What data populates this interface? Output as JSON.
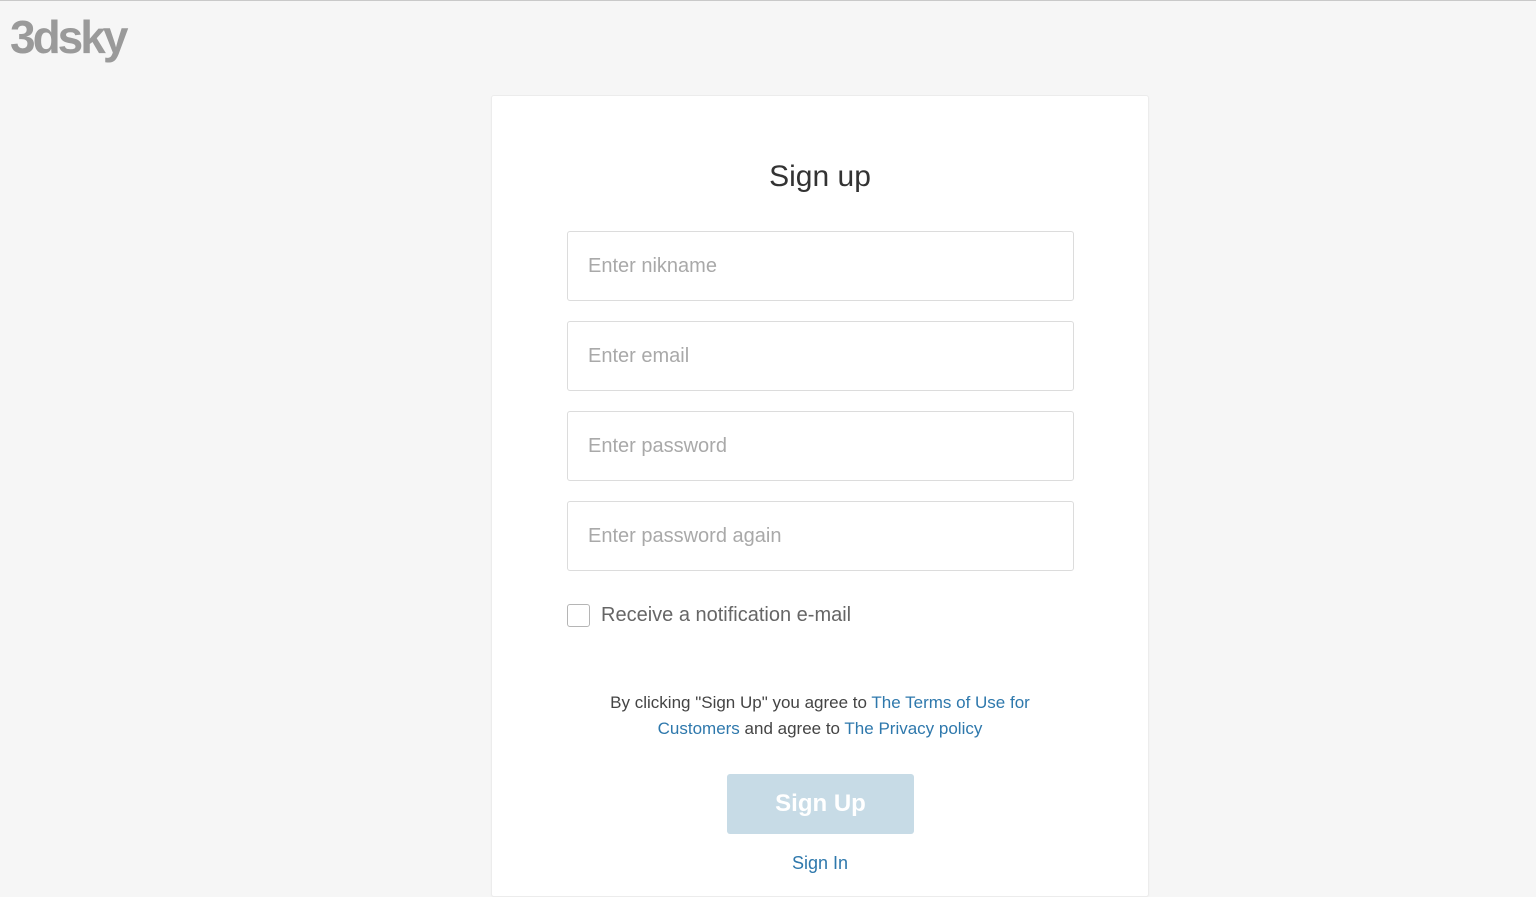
{
  "brand": {
    "logo_text": "3dsky",
    "logo_color": "#9a9a9a"
  },
  "form": {
    "title": "Sign up",
    "nickname": {
      "placeholder": "Enter nikname",
      "value": ""
    },
    "email": {
      "placeholder": "Enter email",
      "value": ""
    },
    "password": {
      "placeholder": "Enter password",
      "value": ""
    },
    "password_again": {
      "placeholder": "Enter password again",
      "value": ""
    },
    "notification_checkbox": {
      "label": "Receive a notification e-mail",
      "checked": false
    },
    "terms": {
      "prefix": "By clicking \"Sign Up\" you agree to ",
      "terms_link": "The Terms of Use for Customers",
      "middle": " and agree to ",
      "privacy_link": "The Privacy policy"
    },
    "submit_label": "Sign Up",
    "signin_label": "Sign In"
  },
  "colors": {
    "background": "#f6f6f6",
    "card": "#ffffff",
    "link": "#2e78ac",
    "button_disabled": "#c7dbe6",
    "placeholder": "#a9a9a9"
  }
}
